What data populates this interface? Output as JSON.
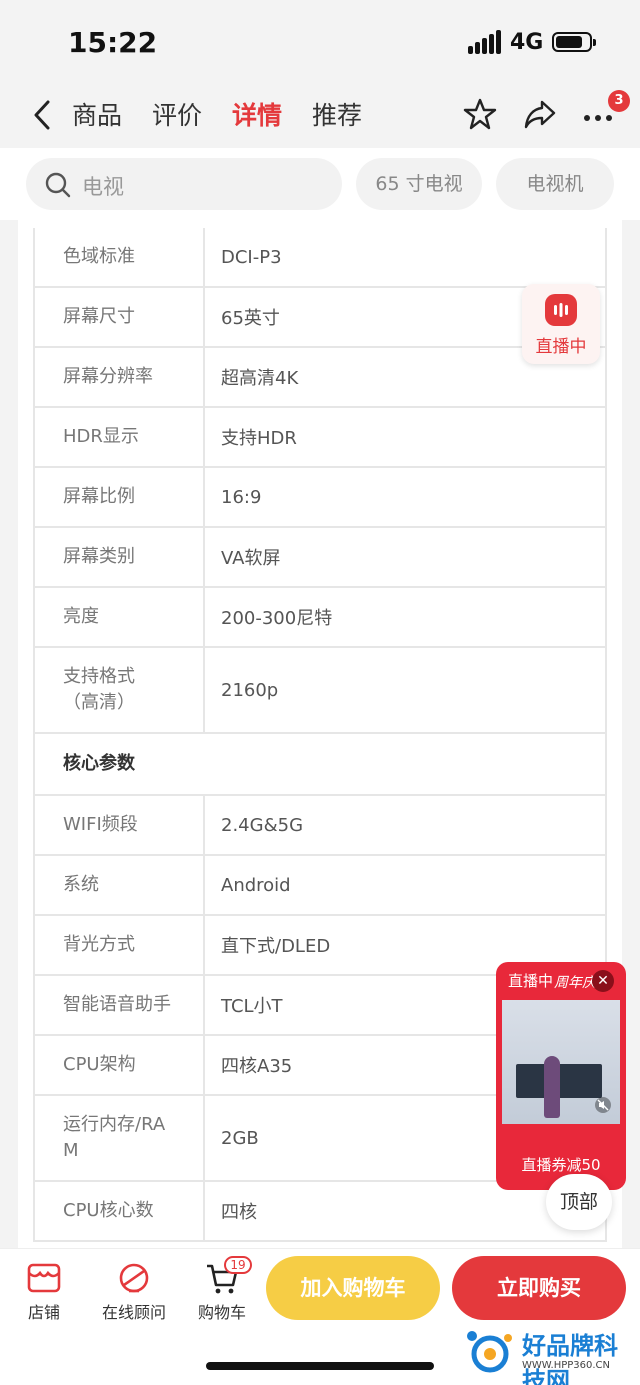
{
  "status_bar": {
    "time": "15:22",
    "network": "4G"
  },
  "nav": {
    "tabs": [
      "商品",
      "评价",
      "详情",
      "推荐"
    ],
    "active_tab": "详情",
    "more_badge": "3"
  },
  "search": {
    "placeholder": "电视",
    "chips": [
      "65 寸电视",
      "电视机"
    ]
  },
  "specs": {
    "rows": [
      {
        "k": "色域标准",
        "v": "DCI-P3"
      },
      {
        "k": "屏幕尺寸",
        "v": "65英寸"
      },
      {
        "k": "屏幕分辨率",
        "v": "超高清4K"
      },
      {
        "k": "HDR显示",
        "v": "支持HDR"
      },
      {
        "k": "屏幕比例",
        "v": "16:9"
      },
      {
        "k": "屏幕类别",
        "v": "VA软屏"
      },
      {
        "k": "亮度",
        "v": "200-300尼特"
      },
      {
        "k": "支持格式（高清）",
        "v": "2160p"
      }
    ],
    "section_title": "核心参数",
    "core_rows": [
      {
        "k": "WIFI频段",
        "v": "2.4G&5G"
      },
      {
        "k": "系统",
        "v": "Android"
      },
      {
        "k": "背光方式",
        "v": "直下式/DLED"
      },
      {
        "k": "智能语音助手",
        "v": "TCL小T"
      },
      {
        "k": "CPU架构",
        "v": "四核A35"
      },
      {
        "k": "运行内存/RAM",
        "v": "2GB"
      },
      {
        "k": "CPU核心数",
        "v": "四核"
      }
    ]
  },
  "live_badge": {
    "label": "直播中"
  },
  "live_card": {
    "tag": "直播中",
    "script": "周年庆",
    "coupon": "直播券减50"
  },
  "top_button": "顶部",
  "bottom_bar": {
    "store": "店铺",
    "advisor": "在线顾问",
    "cart": "购物车",
    "cart_count": "19",
    "add_to_cart": "加入购物车",
    "buy_now": "立即购买"
  },
  "watermark": {
    "name": "好品牌科技网",
    "url": "WWW.HPP360.CN"
  }
}
